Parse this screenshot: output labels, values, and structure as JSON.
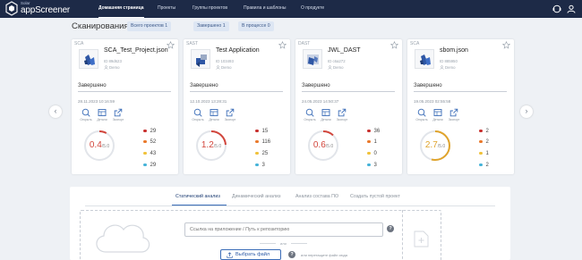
{
  "header": {
    "brand_small": "Solar",
    "brand": "appScreener",
    "nav": [
      {
        "label": "Домашняя страница",
        "active": true
      },
      {
        "label": "Проекты"
      },
      {
        "label": "Группы проектов"
      },
      {
        "label": "Правила и шаблоны"
      },
      {
        "label": "О продукте"
      }
    ],
    "icons": [
      "support-icon",
      "user-icon"
    ]
  },
  "scans": {
    "title": "Сканирования",
    "chips": [
      "Всего проектов 1",
      "Завершено 1",
      "В процессе 0"
    ]
  },
  "cards": [
    {
      "type": "SCA",
      "name": "SCA_Test_Project.json",
      "id": "ID 89d623",
      "team": "Demo",
      "status": "Завершено",
      "date": "28.11.2023 10:16:59",
      "actions": [
        "Открыть",
        "Детали",
        "Экспорт"
      ],
      "score": "0.4",
      "score_max": "/5.0",
      "score_fraction": 0.08,
      "score_color": "#d2463c",
      "severity": [
        "29",
        "52",
        "43",
        "29"
      ]
    },
    {
      "type": "SAST",
      "name": "Test Application",
      "id": "ID 103493",
      "team": "Demo",
      "status": "Завершено",
      "date": "12.10.2023 13:28:31",
      "actions": [
        "Открыть",
        "Детали",
        "Экспорт"
      ],
      "score": "1.2",
      "score_max": "/5.0",
      "score_fraction": 0.24,
      "score_color": "#d2463c",
      "severity": [
        "15",
        "116",
        "25",
        "3"
      ]
    },
    {
      "type": "DAST",
      "name": "JWL_DAST",
      "id": "ID c6a272",
      "team": "Demo",
      "status": "Завершено",
      "date": "24.05.2023 14:50:37",
      "actions": [
        "Открыть",
        "Детали",
        "Экспорт"
      ],
      "score": "0.6",
      "score_max": "/5.0",
      "score_fraction": 0.12,
      "score_color": "#d2463c",
      "severity": [
        "36",
        "1",
        "0",
        "3"
      ]
    },
    {
      "type": "SCA",
      "name": "sbom.json",
      "id": "ID 885950",
      "team": "Demo",
      "status": "Завершено",
      "date": "19.05.2023 02:55:58",
      "actions": [
        "Открыть",
        "Детали",
        "Экспорт"
      ],
      "score": "2.7",
      "score_max": "/5.0",
      "score_fraction": 0.54,
      "score_color": "#e0a42c",
      "severity": [
        "2",
        "2",
        "1",
        "2"
      ]
    }
  ],
  "severity_colors": [
    "#c8302d",
    "#e9792a",
    "#f0c23a",
    "#45b3d8"
  ],
  "tabs": [
    {
      "label": "Статический анализ",
      "active": true
    },
    {
      "label": "Динамический анализ"
    },
    {
      "label": "Анализ состава ПО"
    },
    {
      "label": "Создать пустой проект"
    }
  ],
  "upload": {
    "placeholder": "Ссылка на приложение / Путь к репозиторию",
    "or": "или",
    "button": "Выбрать файл",
    "drag_note": "или перетащите файл сюда"
  },
  "colors": {
    "topbar": "#1d2a47",
    "accent": "#3b6db8"
  }
}
